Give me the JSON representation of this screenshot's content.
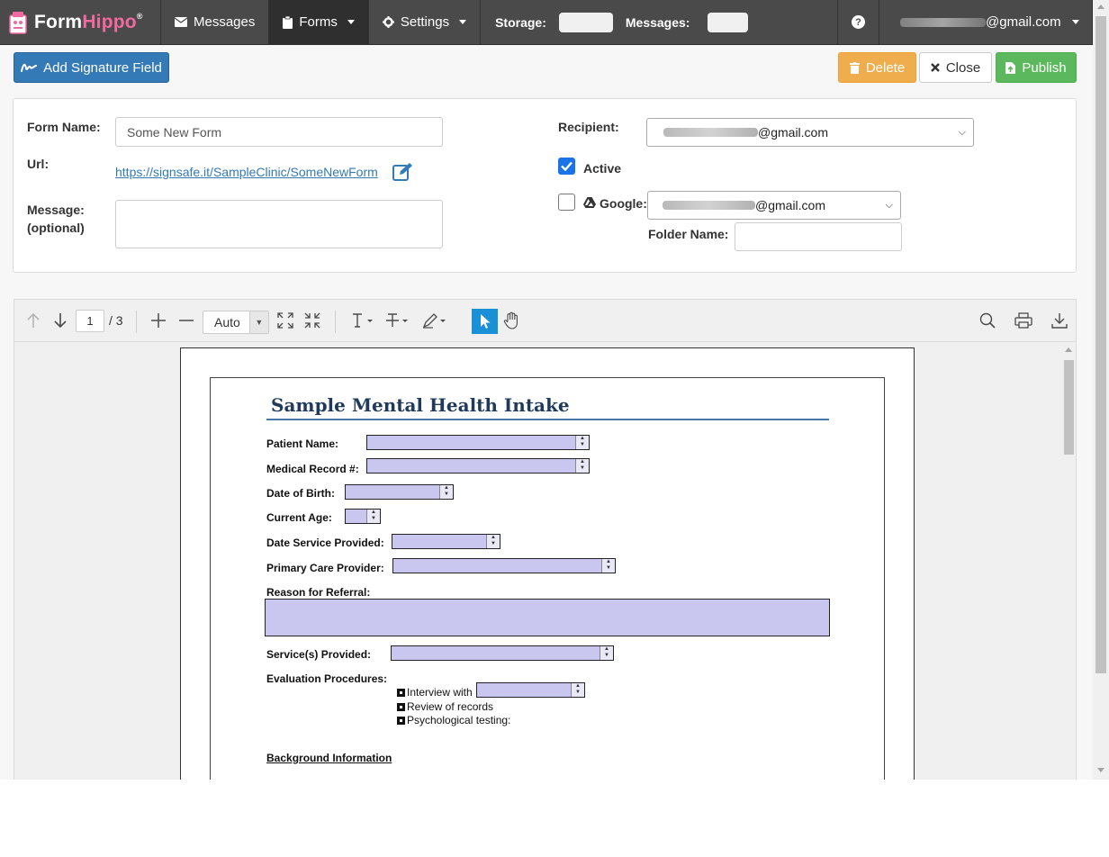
{
  "brand": {
    "name_part1": "Form",
    "name_part2": "Hippo",
    "mark": "®",
    "colors": {
      "accent": "#f06aa0"
    }
  },
  "nav": {
    "messages": "Messages",
    "forms": "Forms",
    "settings": "Settings",
    "storage_label": "Storage:",
    "messages_label": "Messages:",
    "help": "?",
    "user_email_suffix": "@gmail.com"
  },
  "toolbar": {
    "add_signature": "Add Signature Field",
    "delete": "Delete",
    "close": "Close",
    "publish": "Publish"
  },
  "form": {
    "name_label": "Form Name:",
    "name_value": "Some New Form",
    "url_label": "Url:",
    "url_value": "https://signsafe.it/SampleClinic/SomeNewForm",
    "message_label": "Message:",
    "message_hint": "(optional)",
    "message_value": "",
    "recipient_label": "Recipient:",
    "recipient_suffix": "@gmail.com",
    "active_label": "Active",
    "active_checked": true,
    "google_label": "Google:",
    "google_checked": false,
    "google_suffix": "@gmail.com",
    "folder_label": "Folder Name:",
    "folder_value": ""
  },
  "viewer": {
    "page_current": "1",
    "page_total": "/ 3",
    "zoom": "Auto"
  },
  "pdf": {
    "title": "Sample Mental Health Intake",
    "fields": {
      "patient_name": "Patient Name:",
      "medical_record": "Medical Record #:",
      "dob": "Date of Birth:",
      "current_age": "Current Age:",
      "date_service": "Date Service Provided:",
      "primary_care": "Primary Care Provider:",
      "reason_referral": "Reason for Referral:",
      "services_provided": "Service(s) Provided:",
      "evaluation": "Evaluation Procedures:",
      "interview_with": "Interview with",
      "review_records": "Review of records",
      "psych_testing": "Psychological testing:",
      "background": "Background Information"
    },
    "colors": {
      "field_fill": "#c9c7ef",
      "title": "#1f3a5a"
    }
  }
}
